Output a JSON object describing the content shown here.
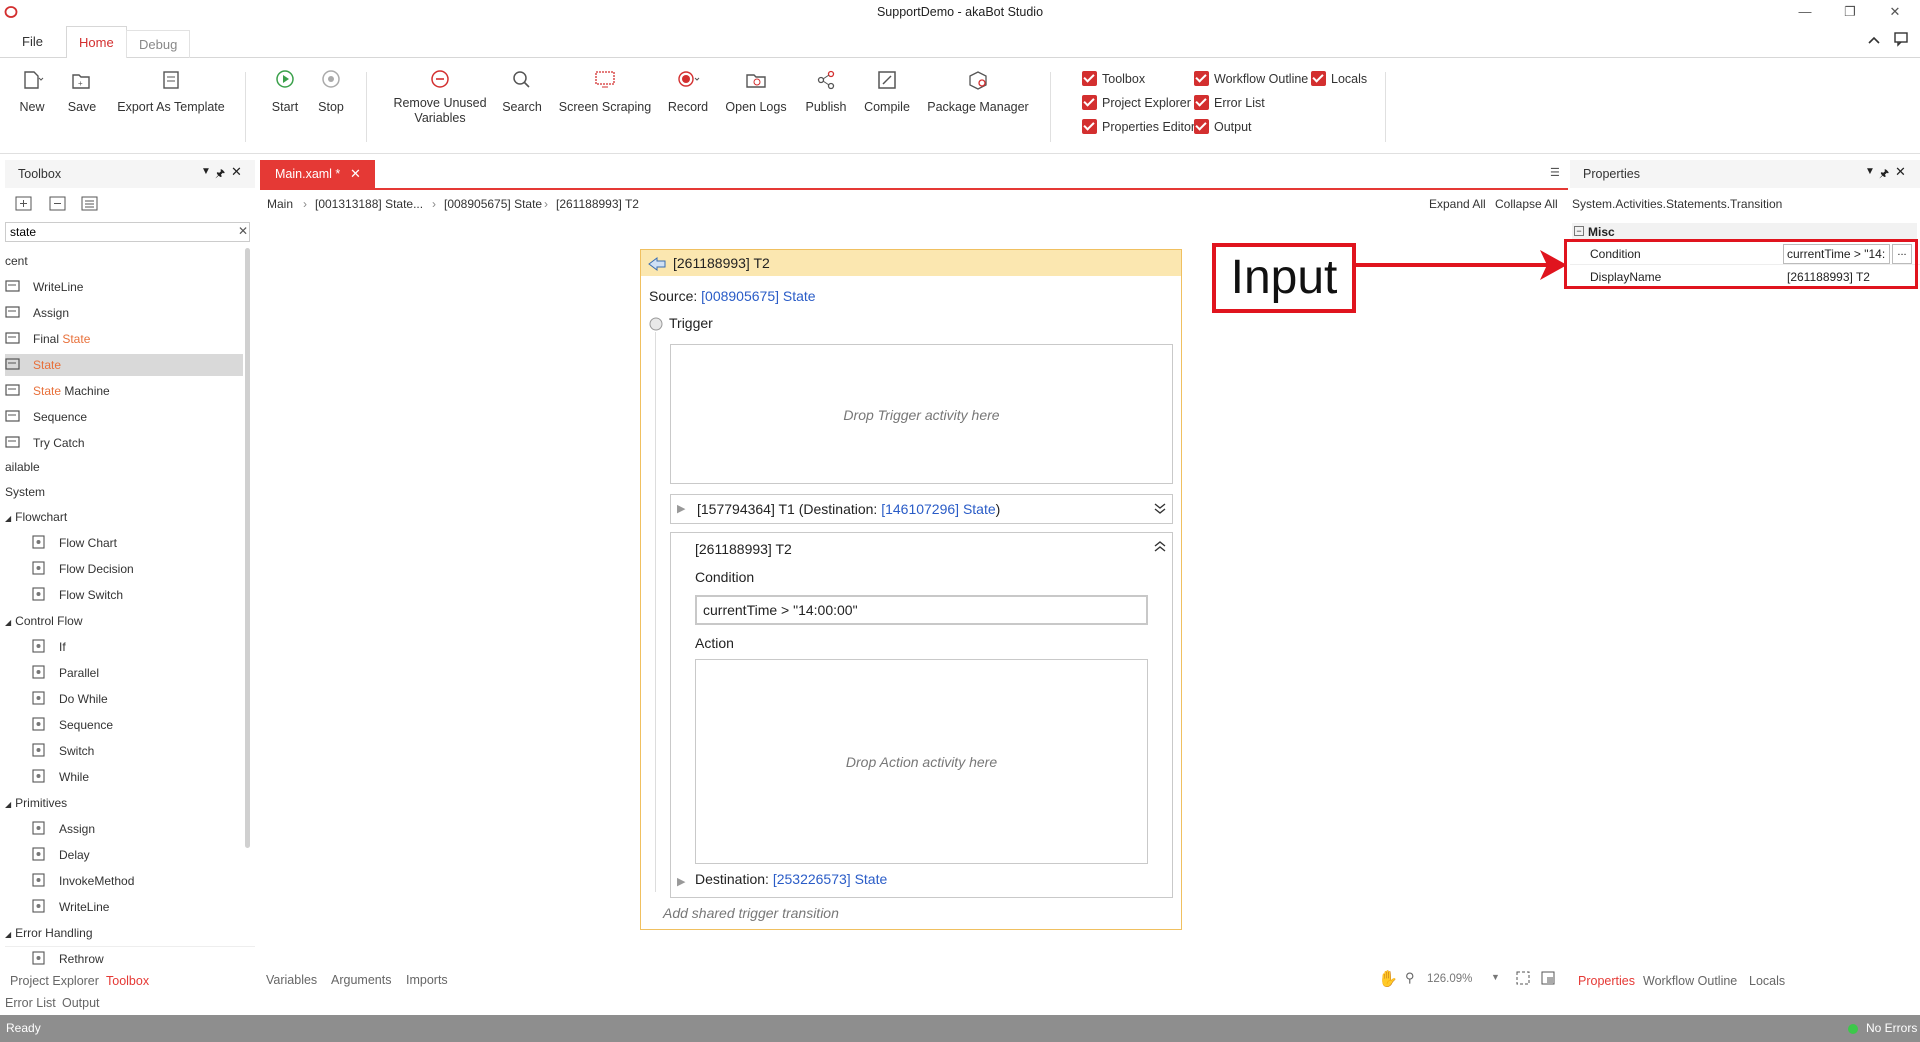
{
  "window": {
    "title": "SupportDemo - akaBot Studio"
  },
  "menu_tabs": [
    "File",
    "Home",
    "Debug"
  ],
  "ribbon": {
    "new": "New",
    "save": "Save",
    "export_template": "Export As Template",
    "start": "Start",
    "stop": "Stop",
    "remove_unused_1": "Remove Unused",
    "remove_unused_2": "Variables",
    "search": "Search",
    "screen_scraping": "Screen Scraping",
    "record": "Record",
    "open_logs": "Open Logs",
    "publish": "Publish",
    "compile": "Compile",
    "package_manager": "Package Manager",
    "checks": {
      "toolbox": "Toolbox",
      "project_explorer": "Project Explorer",
      "properties_editor": "Properties Editor",
      "workflow_outline": "Workflow Outline",
      "error_list": "Error List",
      "output": "Output",
      "locals": "Locals"
    }
  },
  "toolbox": {
    "title": "Toolbox",
    "search_value": "state",
    "recent_label": "cent",
    "recent_items": [
      {
        "label": "WriteLine",
        "pre": "",
        "hl": "",
        "post": ""
      },
      {
        "label": "Assign",
        "pre": "",
        "hl": "",
        "post": ""
      },
      {
        "label": "",
        "pre": "Final ",
        "hl": "State",
        "post": ""
      },
      {
        "label": "",
        "pre": "",
        "hl": "State",
        "post": ""
      },
      {
        "label": "",
        "pre": "",
        "hl": "State",
        "post": " Machine"
      },
      {
        "label": "Sequence",
        "pre": "",
        "hl": "",
        "post": ""
      },
      {
        "label": "Try Catch",
        "pre": "",
        "hl": "",
        "post": ""
      }
    ],
    "available_label": "ailable",
    "system_label": "System",
    "groups": [
      {
        "name": "Flowchart",
        "items": [
          "Flow Chart",
          "Flow Decision",
          "Flow Switch"
        ]
      },
      {
        "name": "Control Flow",
        "items": [
          "If",
          "Parallel",
          "Do While",
          "Sequence",
          "Switch",
          "While"
        ]
      },
      {
        "name": "Primitives",
        "items": [
          "Assign",
          "Delay",
          "InvokeMethod",
          "WriteLine"
        ]
      },
      {
        "name": "Error Handling",
        "items": [
          "Rethrow"
        ]
      }
    ]
  },
  "bottom_left_tabs": {
    "project_explorer": "Project Explorer",
    "toolbox": "Toolbox",
    "error_list": "Error List",
    "output": "Output"
  },
  "document": {
    "tab_label": "Main.xaml *",
    "breadcrumb": [
      "Main",
      "[001313188] State...",
      "[008905675] State",
      "[261188993] T2"
    ],
    "expand_all": "Expand All",
    "collapse_all": "Collapse All"
  },
  "card": {
    "title": "[261188993] T2",
    "source_label": "Source: ",
    "source_link": "[008905675] State",
    "trigger_label": "Trigger",
    "trigger_drop": "Drop Trigger activity here",
    "t1_text": "[157794364] T1 (Destination: ",
    "t1_link": "[146107296] State",
    "t1_close": ")",
    "t2_title": "[261188993] T2",
    "condition_label": "Condition",
    "condition_value": "currentTime > \"14:00:00\"",
    "action_label": "Action",
    "action_drop": "Drop Action activity here",
    "destination_label": "Destination: ",
    "destination_link": "[253226573] State",
    "add_shared": "Add shared trigger transition"
  },
  "annotation": {
    "text": "Input",
    "color": "#e0141e"
  },
  "canvas_footer": {
    "variables": "Variables",
    "arguments": "Arguments",
    "imports": "Imports",
    "zoom": "126.09%"
  },
  "properties": {
    "title": "Properties",
    "type_name": "System.Activities.Statements.Transition",
    "category": "Misc",
    "rows": [
      {
        "name": "Condition",
        "value": "currentTime > \"14:"
      },
      {
        "name": "DisplayName",
        "value": "[261188993] T2"
      }
    ],
    "ellipsis": "...",
    "tabs": [
      "Properties",
      "Workflow Outline",
      "Locals"
    ]
  },
  "status": {
    "left": "Ready",
    "right": "No Errors"
  },
  "colors": {
    "accent": "#e53935",
    "status_bar": "#8e8e8e",
    "link": "#2a5cc7"
  }
}
